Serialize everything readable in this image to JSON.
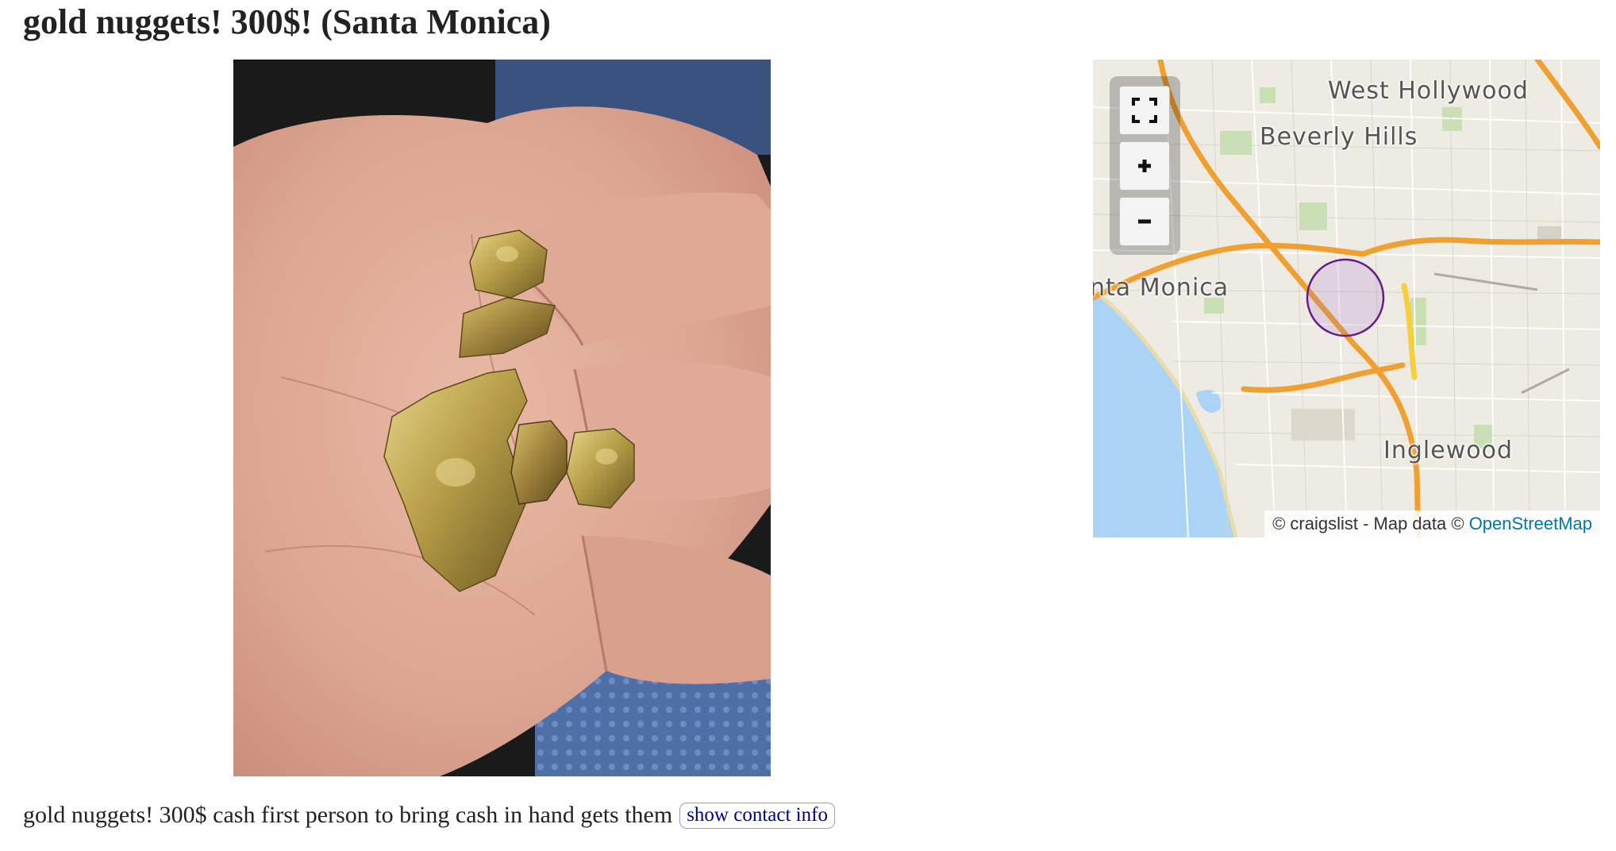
{
  "post": {
    "title": "gold nuggets! 300$! (Santa Monica)",
    "body": "gold nuggets! 300$ cash first person to bring cash in hand gets them",
    "contact_button": "show contact info"
  },
  "map": {
    "labels": {
      "west_hollywood": "West Hollywood",
      "beverly_hills": "Beverly Hills",
      "santa_monica": "nta Monica",
      "inglewood": "Inglewood"
    },
    "attribution_prefix": "© craigslist - Map data ©",
    "attribution_link": "OpenStreetMap",
    "controls": [
      "fullscreen-icon",
      "zoom-in-icon",
      "zoom-out-icon"
    ]
  },
  "colors": {
    "link": "#00008b",
    "osm_link": "#0078a8",
    "water": "#aad3f5",
    "highway": "#f0a030",
    "radius_circle": "#6a1b8a"
  }
}
